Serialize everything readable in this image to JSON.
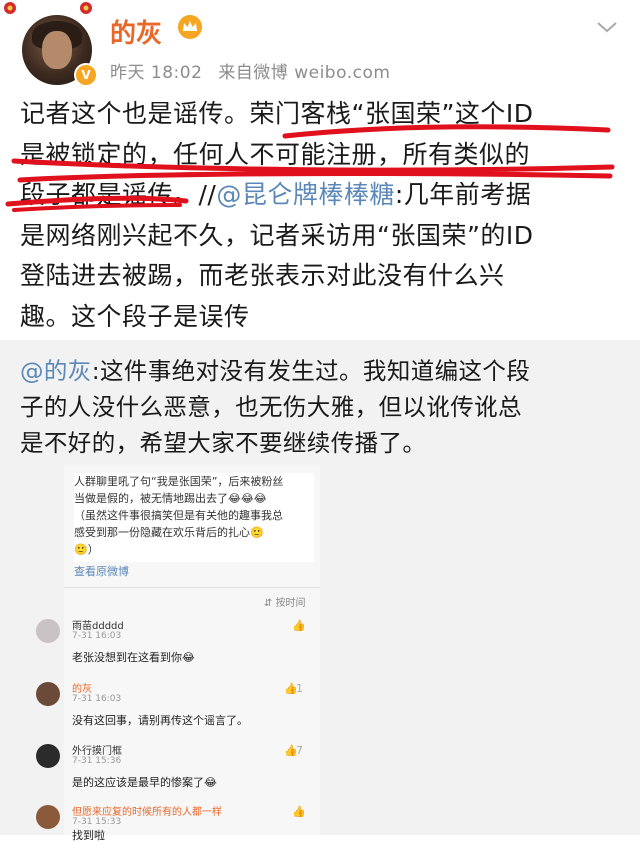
{
  "header": {
    "username": "的灰",
    "time": "昨天 18:02",
    "source": "来自微博 weibo.com",
    "verified": "V"
  },
  "post": {
    "lines": [
      "记者这个也是谣传。荣门客栈“张国荣”这个ID",
      "是被锁定的，任何人不可能注册，所有类似的",
      "段子都是谣传。//",
      "是网络刚兴起不久，记者采访用“张国荣”的ID",
      "登陆进去被踢，而老张表示对此没有什么兴",
      "趣。这个段子是误传"
    ],
    "mention": "@昆仑牌棒棒糖",
    "after_mention": ":几年前考据"
  },
  "repost": {
    "mention": "@的灰",
    "lines": [
      ":这件事绝对没有发生过。我知道编这个段",
      "子的人没什么恶意，也无伤大雅，但以讹传讹总",
      "是不好的，希望大家不要继续传播了。"
    ]
  },
  "screenshot": {
    "quote_lines": [
      "人群聊里吼了句“我是张国荣”，后来被粉丝",
      "当做是假的，被无情地踢出去了😂😂😂",
      "（虽然这件事很搞笑但是有关他的趣事我总",
      "感受到那一份隐藏在欢乐背后的扎心🙂",
      "🙂）"
    ],
    "view_original": "查看原微博",
    "sort": "按时间",
    "comments": [
      {
        "name": "雨苗ddddd",
        "time": "7-31 16:03",
        "text": "老张没想到在这看到你😂",
        "likes": ""
      },
      {
        "name": "的灰",
        "time": "7-31 16:03",
        "text": "没有这回事，请别再传这个谣言了。",
        "likes": "1"
      },
      {
        "name": "外行摸门框",
        "time": "7-31 15:36",
        "text": "是的这应该是最早的惨案了😂",
        "likes": "7"
      },
      {
        "name": "但愿来应复的时候所有的人都一样",
        "time": "7-31 15:33",
        "text": "找到啦",
        "likes": ""
      }
    ]
  },
  "colors": {
    "username": "#e8682a",
    "mention": "#5b88b8",
    "scribble": "#e0101c",
    "repost_bg": "#f2f2f2"
  },
  "icons": [
    "crown-icon",
    "chevron-down-icon",
    "verified-badge-icon",
    "like-thumb-icon",
    "sort-icon"
  ]
}
